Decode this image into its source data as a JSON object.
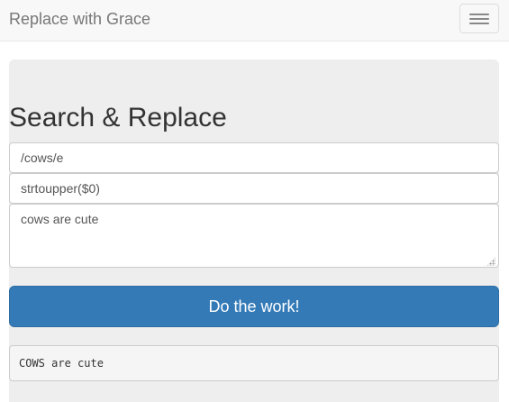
{
  "navbar": {
    "brand": "Replace with Grace",
    "toggle_icon": "hamburger-menu-icon"
  },
  "main": {
    "heading": "Search & Replace",
    "pattern_value": "/cows/e",
    "replacement_value": "strtoupper($0)",
    "subject_value": "cows are cute",
    "submit_label": "Do the work!",
    "result": "COWS are cute"
  },
  "colors": {
    "navbar_bg": "#f8f8f8",
    "jumbotron_bg": "#eeeeee",
    "primary": "#337ab7",
    "result_bg": "#f5f5f5"
  }
}
